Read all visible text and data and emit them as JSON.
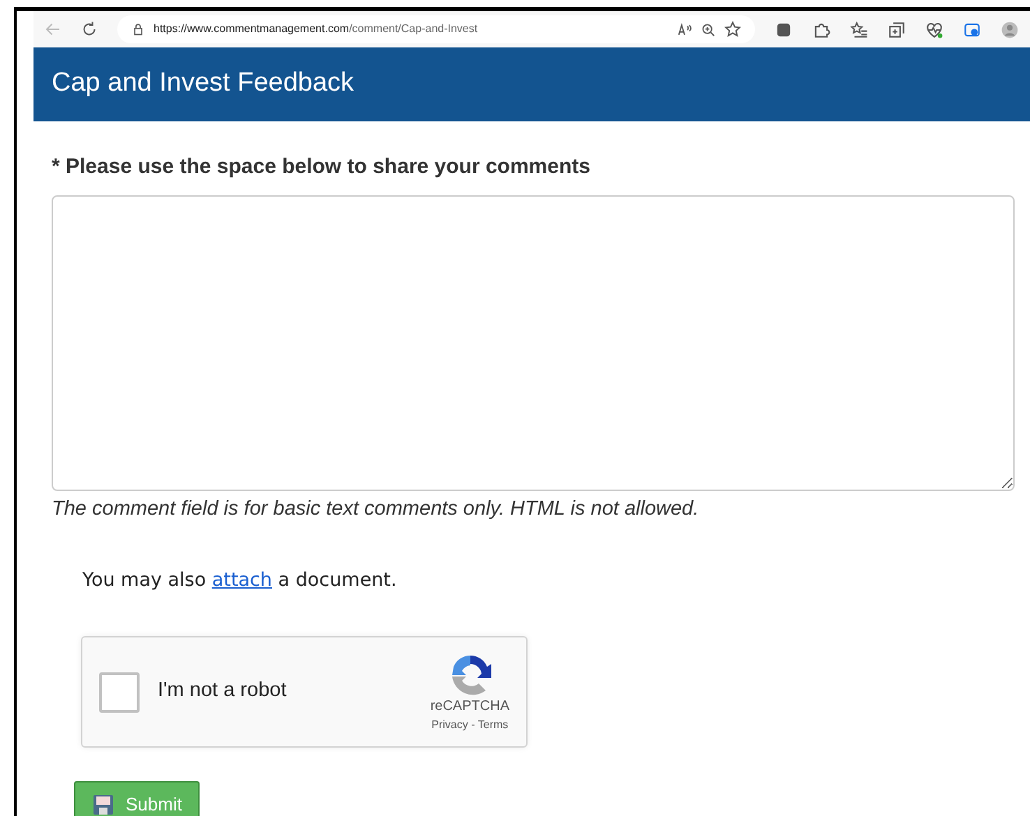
{
  "browser": {
    "url_host": "https://www.commentmanagement.com",
    "url_path": "/comment/Cap-and-Invest"
  },
  "header": {
    "title": "Cap and Invest Feedback"
  },
  "comment": {
    "label": "* Please use the space below to share your comments",
    "hint": "The comment field is for basic text comments only. HTML is not allowed."
  },
  "attach_note": {
    "before": "You may also ",
    "link": "attach",
    "after": " a document."
  },
  "captcha": {
    "label": "I'm not a robot",
    "checked": false,
    "brand": "reCAPTCHA",
    "privacy": "Privacy",
    "separator": "-",
    "terms": "Terms"
  },
  "submit": {
    "label": "Submit"
  }
}
